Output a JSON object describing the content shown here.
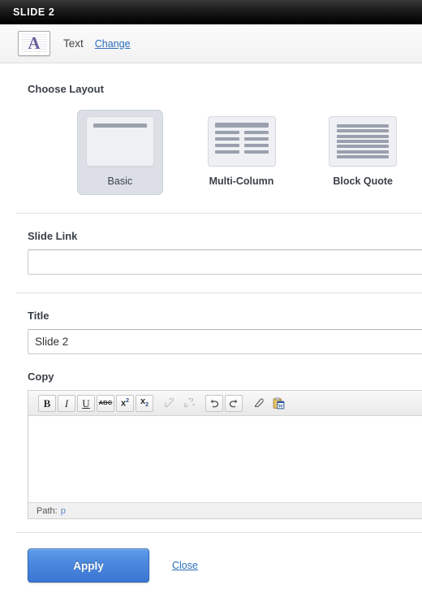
{
  "window": {
    "title": "SLIDE 2"
  },
  "typebar": {
    "icon": "text-type-icon",
    "label": "Text",
    "change_link": "Change"
  },
  "layout": {
    "heading": "Choose Layout",
    "options": [
      {
        "label": "Basic",
        "id": "basic",
        "selected": true
      },
      {
        "label": "Multi-Column",
        "id": "multi-column",
        "selected": false
      },
      {
        "label": "Block Quote",
        "id": "block-quote",
        "selected": false
      }
    ]
  },
  "slide_link": {
    "label": "Slide Link",
    "value": "",
    "placeholder": ""
  },
  "title_field": {
    "label": "Title",
    "value": "Slide 2",
    "placeholder": ""
  },
  "copy": {
    "label": "Copy",
    "toolbar": [
      {
        "name": "bold-button",
        "glyph": "B",
        "disabled": false
      },
      {
        "name": "italic-button",
        "glyph": "I",
        "disabled": false
      },
      {
        "name": "underline-button",
        "glyph": "U",
        "disabled": false
      },
      {
        "name": "strikethrough-button",
        "glyph": "ABC",
        "disabled": false
      },
      {
        "name": "superscript-button",
        "glyph": "x2",
        "disabled": false
      },
      {
        "name": "subscript-button",
        "glyph": "x2",
        "disabled": false
      },
      {
        "name": "link-button",
        "glyph": "link",
        "disabled": true
      },
      {
        "name": "unlink-button",
        "glyph": "unlink",
        "disabled": true
      },
      {
        "name": "undo-button",
        "glyph": "undo",
        "disabled": false
      },
      {
        "name": "redo-button",
        "glyph": "redo",
        "disabled": false
      },
      {
        "name": "remove-format-button",
        "glyph": "eraser",
        "disabled": false
      },
      {
        "name": "paste-from-word-button",
        "glyph": "word",
        "disabled": false
      }
    ],
    "body_value": "",
    "path_label": "Path:",
    "path_value": "p"
  },
  "footer": {
    "apply_label": "Apply",
    "close_label": "Close"
  },
  "colors": {
    "titlebar_bg": "#000000",
    "accent_link": "#2a6ebb",
    "apply_button": "#4a86dd",
    "selected_layout_bg": "#dcdfe6",
    "thumb_bar": "#9aa0ad",
    "type_glyph": "#6b5f9e"
  }
}
